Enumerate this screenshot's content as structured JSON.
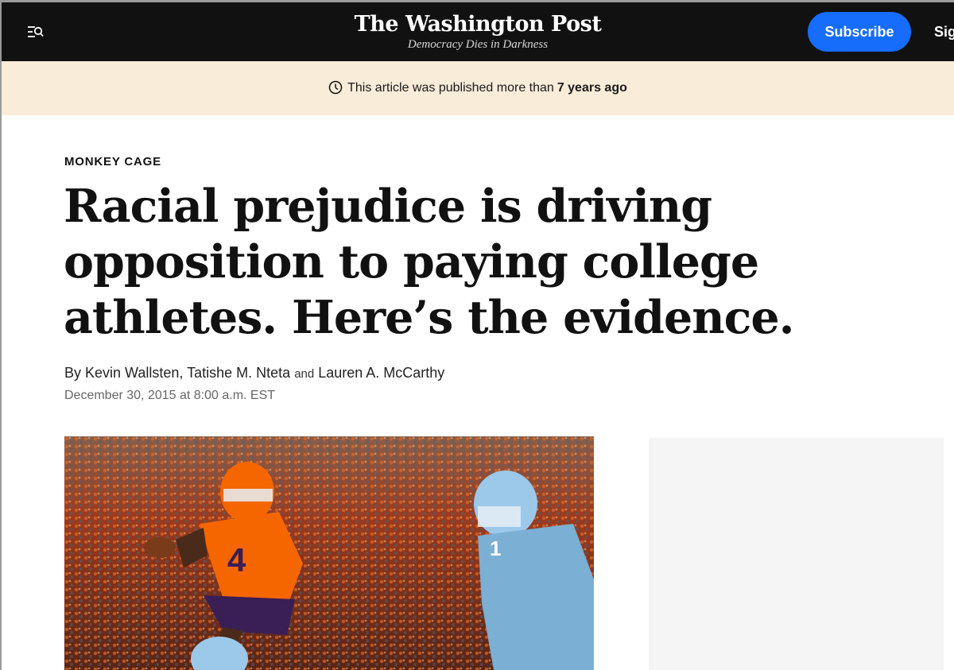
{
  "header": {
    "logo_title": "The Washington Post",
    "logo_tagline": "Democracy Dies in Darkness",
    "subscribe_label": "Subscribe",
    "signin_label": "Sig",
    "menu_icon": "menu-search-icon"
  },
  "notice": {
    "icon": "clock-icon",
    "text": "This article was published more than",
    "emphasis": "7 years ago",
    "background": "#f9ecd8"
  },
  "article": {
    "kicker": "MONKEY CAGE",
    "headline": "Racial prejudice is driving opposition to paying college athletes. Here’s the evidence.",
    "byline_prefix": "By",
    "authors": [
      "Kevin Wallsten,",
      "Tatishe M. Nteta",
      "Lauren A. McCarthy"
    ],
    "byline_and": "and",
    "date": "December 30, 2015 at 8:00 a.m. EST"
  },
  "colors": {
    "topbar": "#111111",
    "subscribe": "#166dfc",
    "clemson_orange": "#f56600",
    "unc_blue": "#7bafd4"
  }
}
